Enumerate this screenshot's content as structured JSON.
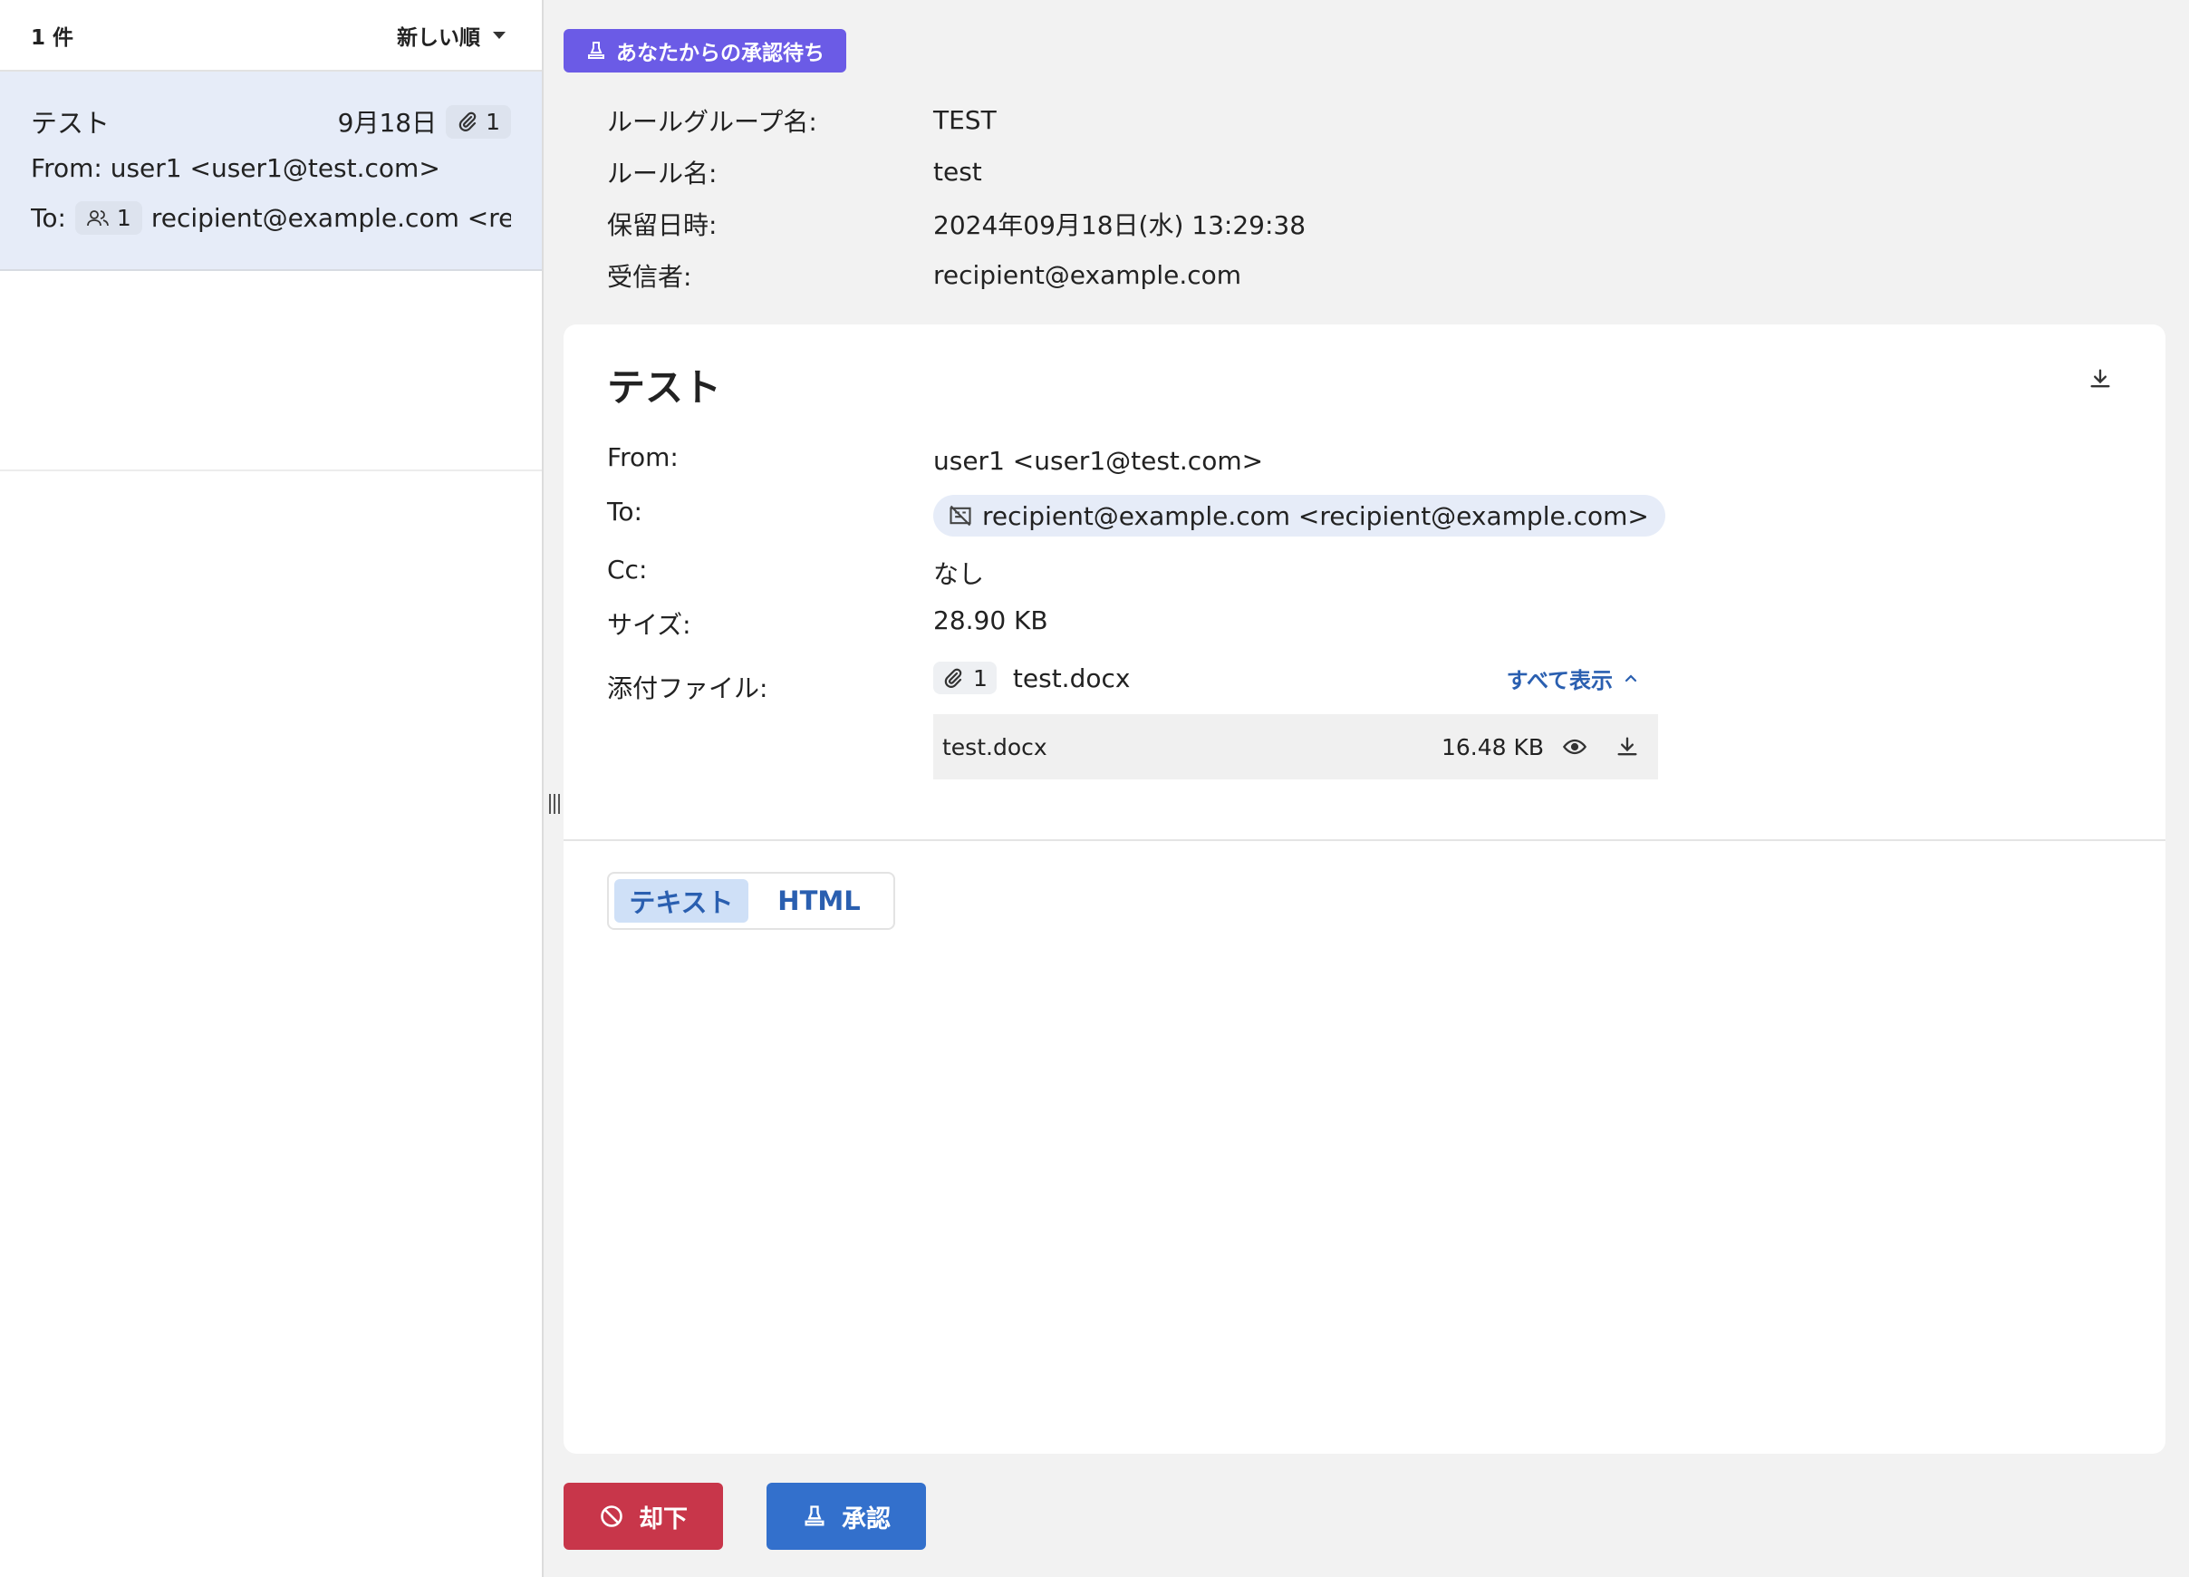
{
  "list": {
    "count": "1 件",
    "sort_label": "新しい順",
    "items": [
      {
        "subject": "テスト",
        "date": "9月18日",
        "attachment_count": "1",
        "from": "From: user1 <user1@test.com>",
        "to_label": "To:",
        "recipient_count": "1",
        "to": "recipient@example.com <rec..."
      }
    ]
  },
  "status_badge": "あなたからの承認待ち",
  "meta": {
    "rule_group_label": "ルールグループ名:",
    "rule_group_value": "TEST",
    "rule_label": "ルール名:",
    "rule_value": "test",
    "held_label": "保留日時:",
    "held_value": "2024年09月18日(水) 13:29:38",
    "recipient_label": "受信者:",
    "recipient_value": "recipient@example.com"
  },
  "message": {
    "subject": "テスト",
    "from_label": "From:",
    "from_value": "user1 <user1@test.com>",
    "to_label": "To:",
    "to_value": "recipient@example.com <recipient@example.com>",
    "cc_label": "Cc:",
    "cc_value": "なし",
    "size_label": "サイズ:",
    "size_value": "28.90 KB",
    "attachments_label": "添付ファイル:",
    "attachment_count": "1",
    "attachment_summary": "test.docx",
    "show_all": "すべて表示",
    "attachments": [
      {
        "name": "test.docx",
        "size": "16.48 KB"
      }
    ]
  },
  "tabs": [
    "テキスト",
    "HTML"
  ],
  "actions": {
    "reject": "却下",
    "approve": "承認"
  },
  "colors": {
    "badge": "#6b5be6",
    "reject": "#c8364a",
    "approve": "#3370cc",
    "link": "#2a5fb0",
    "selected_item": "#e6ecf8"
  },
  "icons": [
    "chevron-down-icon",
    "paperclip-icon",
    "users-icon",
    "stamp-icon",
    "download-icon",
    "no-photo-icon",
    "chevron-up-icon",
    "eye-icon",
    "ban-icon"
  ]
}
